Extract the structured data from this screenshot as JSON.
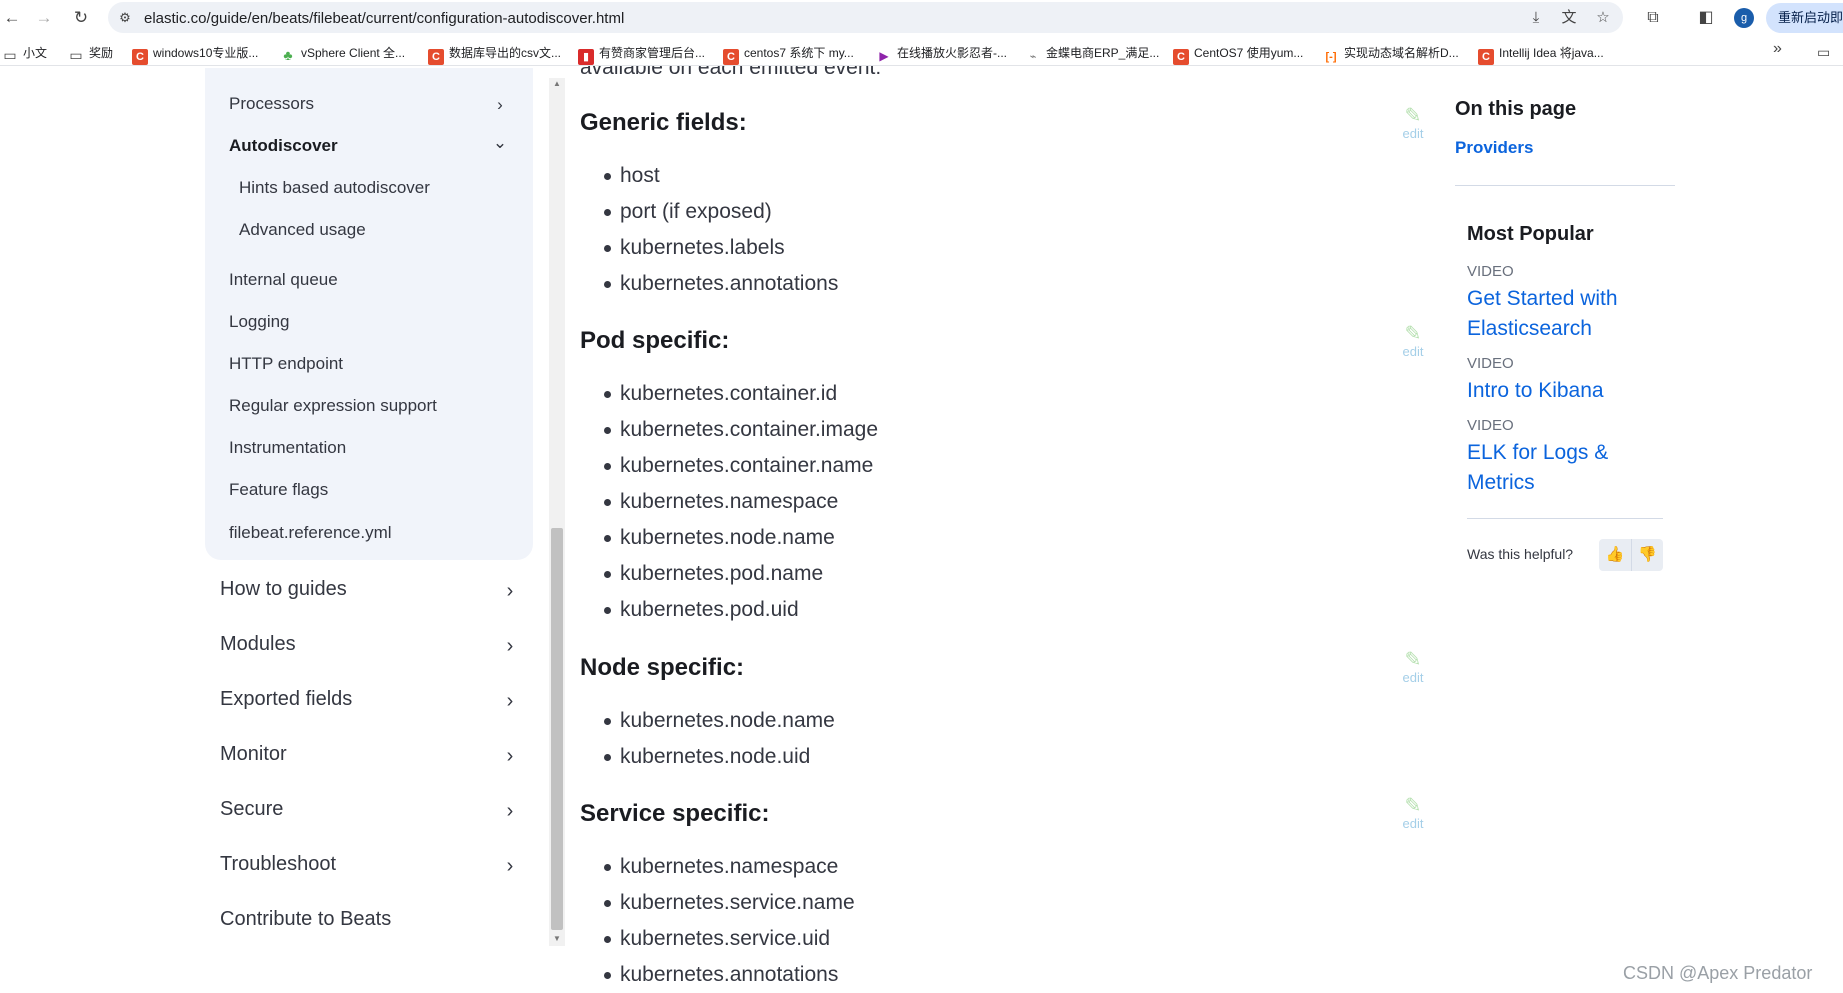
{
  "browser": {
    "url": "elastic.co/guide/en/beats/filebeat/current/configuration-autodiscover.html",
    "profile_initial": "g",
    "restart_label": "重新启动即可",
    "bookmarks": [
      {
        "label": "小文",
        "icon": "folder-icon"
      },
      {
        "label": "奖励",
        "icon": "folder-icon"
      },
      {
        "label": "windows10专业版...",
        "icon": "csdn-icon"
      },
      {
        "label": "vSphere Client 全...",
        "icon": "tree-icon"
      },
      {
        "label": "数据库导出的csv文...",
        "icon": "csdn-icon"
      },
      {
        "label": "有赞商家管理后台...",
        "icon": "red-icon"
      },
      {
        "label": "centos7 系统下 my...",
        "icon": "csdn-icon"
      },
      {
        "label": "在线播放火影忍者-...",
        "icon": "play-icon"
      },
      {
        "label": "金蝶电商ERP_满足...",
        "icon": "grey-icon"
      },
      {
        "label": "CentOS7 使用yum...",
        "icon": "csdn-icon"
      },
      {
        "label": "实现动态域名解析D...",
        "icon": "bracket-icon"
      },
      {
        "label": "Intellij Idea 将java...",
        "icon": "csdn-icon"
      }
    ]
  },
  "sidebar": {
    "sub_items": [
      {
        "label": "Processors",
        "chevron": "›"
      },
      {
        "label": "Autodiscover",
        "chevron": "⌄"
      },
      {
        "label": "Hints based autodiscover"
      },
      {
        "label": "Advanced usage"
      },
      {
        "label": "Internal queue"
      },
      {
        "label": "Logging"
      },
      {
        "label": "HTTP endpoint"
      },
      {
        "label": "Regular expression support"
      },
      {
        "label": "Instrumentation"
      },
      {
        "label": "Feature flags"
      },
      {
        "label": "filebeat.reference.yml"
      }
    ],
    "top_items": [
      {
        "label": "How to guides"
      },
      {
        "label": "Modules"
      },
      {
        "label": "Exported fields"
      },
      {
        "label": "Monitor"
      },
      {
        "label": "Secure"
      },
      {
        "label": "Troubleshoot"
      },
      {
        "label": "Contribute to Beats"
      }
    ]
  },
  "content": {
    "cut_off_text": "available on each emitted event:",
    "edit_label": "edit",
    "sections": [
      {
        "title": "Generic fields:",
        "fields": [
          "host",
          "port (if exposed)",
          "kubernetes.labels",
          "kubernetes.annotations"
        ]
      },
      {
        "title": "Pod specific:",
        "fields": [
          "kubernetes.container.id",
          "kubernetes.container.image",
          "kubernetes.container.name",
          "kubernetes.namespace",
          "kubernetes.node.name",
          "kubernetes.pod.name",
          "kubernetes.pod.uid"
        ]
      },
      {
        "title": "Node specific:",
        "fields": [
          "kubernetes.node.name",
          "kubernetes.node.uid"
        ]
      },
      {
        "title": "Service specific:",
        "fields": [
          "kubernetes.namespace",
          "kubernetes.service.name",
          "kubernetes.service.uid",
          "kubernetes.annotations"
        ]
      }
    ]
  },
  "right": {
    "on_this_page": "On this page",
    "providers_link": "Providers",
    "most_popular": "Most Popular",
    "popular": [
      {
        "kind": "VIDEO",
        "line1": "Get Started with",
        "line2": "Elasticsearch"
      },
      {
        "kind": "VIDEO",
        "line1": "Intro to Kibana",
        "line2": ""
      },
      {
        "kind": "VIDEO",
        "line1": "ELK for Logs &",
        "line2": "Metrics"
      }
    ],
    "helpful": "Was this helpful?"
  },
  "watermark": "CSDN @Apex   Predator",
  "colors": {
    "link": "#0b64dd",
    "subnav_bg": "#f1f4fa",
    "text": "#343741"
  }
}
